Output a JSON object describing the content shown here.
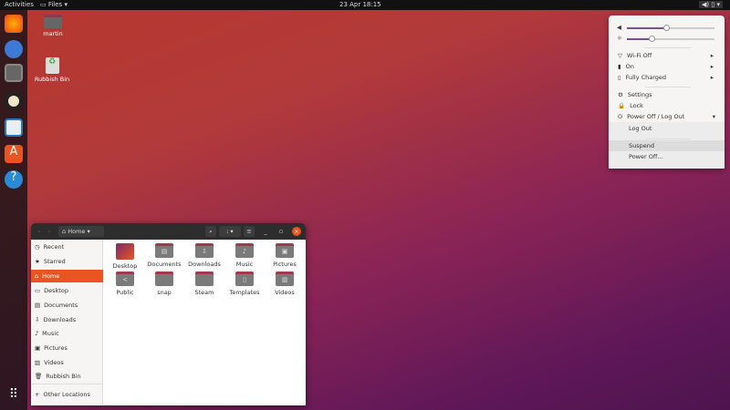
{
  "topbar": {
    "activities": "Activities",
    "app_menu": "Files",
    "clock": "23 Apr  18:15"
  },
  "dock": [
    "firefox-icon",
    "thunderbird-icon",
    "files-icon",
    "rhythmbox-icon",
    "libreoffice-writer-icon",
    "software-icon",
    "help-icon",
    "show-apps-icon"
  ],
  "desktop": {
    "icons": [
      {
        "label": "martin",
        "icon": "home-folder-icon"
      },
      {
        "label": "Rubbish Bin",
        "icon": "trash-icon"
      }
    ]
  },
  "files": {
    "location": "Home",
    "sidebar": [
      {
        "label": "Recent",
        "icon": "clock-icon"
      },
      {
        "label": "Starred",
        "icon": "star-icon"
      },
      {
        "label": "Home",
        "icon": "home-icon",
        "active": true
      },
      {
        "label": "Desktop",
        "icon": "desktop-icon"
      },
      {
        "label": "Documents",
        "icon": "documents-icon"
      },
      {
        "label": "Downloads",
        "icon": "download-icon"
      },
      {
        "label": "Music",
        "icon": "music-icon"
      },
      {
        "label": "Pictures",
        "icon": "pictures-icon"
      },
      {
        "label": "Videos",
        "icon": "videos-icon"
      },
      {
        "label": "Rubbish Bin",
        "icon": "trash-icon"
      },
      {
        "label": "Other Locations",
        "icon": "plus-icon"
      }
    ],
    "items": [
      "Desktop",
      "Documents",
      "Downloads",
      "Music",
      "Pictures",
      "Public",
      "snap",
      "Steam",
      "Templates",
      "Videos"
    ],
    "accent": "#e95420"
  },
  "menu": {
    "volume": 0.45,
    "brightness": 0.28,
    "items": {
      "wifi": "Wi-Fi Off",
      "bluetooth": "On",
      "battery": "Fully Charged",
      "settings": "Settings",
      "lock": "Lock",
      "power": "Power Off / Log Out",
      "logout": "Log Out",
      "suspend": "Suspend",
      "poweroff": "Power Off…"
    }
  }
}
